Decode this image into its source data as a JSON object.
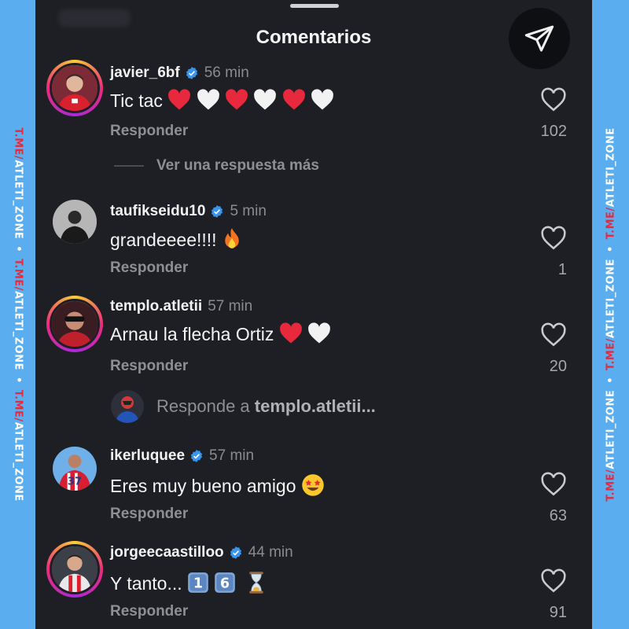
{
  "watermark": {
    "prefix": "T.ME/",
    "suffix": "ATLETI_ZONE",
    "separator": "•"
  },
  "sheet": {
    "title": "Comentarios",
    "share_icon": "send-icon"
  },
  "more_replies_label": "Ver una respuesta más",
  "reply_prompt": {
    "prefix": "Responde a ",
    "user": "templo.atletii..."
  },
  "comments": [
    {
      "username": "javier_6bf",
      "verified": true,
      "time": "56 min",
      "text": "Tic tac",
      "emojis": [
        "❤️",
        "🤍",
        "❤️",
        "🤍",
        "❤️",
        "🤍"
      ],
      "reply_label": "Responder",
      "likes": "102"
    },
    {
      "username": "taufikseidu10",
      "verified": true,
      "time": "5 min",
      "text": "grandeeee!!!!",
      "emojis": [
        "🔥"
      ],
      "reply_label": "Responder",
      "likes": "1"
    },
    {
      "username": "templo.atletii",
      "verified": false,
      "time": "57 min",
      "text": "Arnau la flecha Ortiz ",
      "emojis": [
        "❤️",
        "🤍"
      ],
      "reply_label": "Responder",
      "likes": "20"
    },
    {
      "username": "ikerluquee",
      "verified": true,
      "time": "57 min",
      "text": "Eres muy bueno amigo",
      "emojis": [
        "🤩"
      ],
      "reply_label": "Responder",
      "likes": "63"
    },
    {
      "username": "jorgeecaastilloo",
      "verified": true,
      "time": "44 min",
      "text": "Y tanto... ",
      "emojis": [
        "1️⃣",
        "6️⃣",
        "⌛"
      ],
      "reply_label": "Responder",
      "likes": "91"
    }
  ],
  "colors": {
    "background": "#1e1f24",
    "side_bars": "#5aaef0",
    "verified": "#3797f0",
    "heart_red": "#e8283c",
    "watermark_red": "#e8283c"
  }
}
